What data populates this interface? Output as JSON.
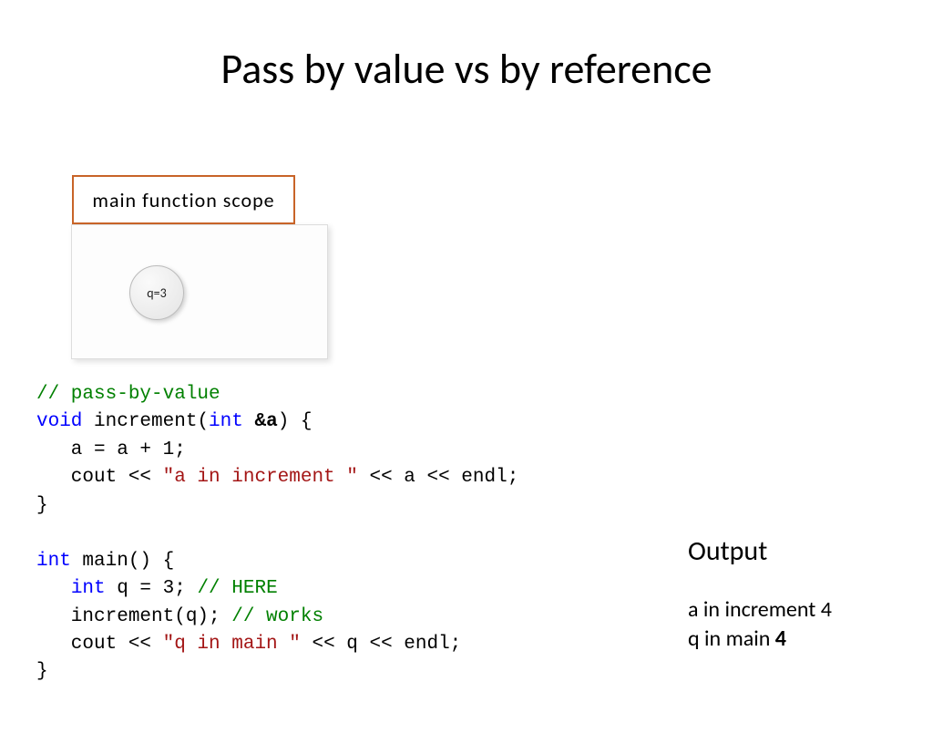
{
  "title": "Pass by value vs by reference",
  "scope": {
    "label": "main function scope",
    "variable": "q=3"
  },
  "code": {
    "l1": "// pass-by-value",
    "l2a": "void",
    "l2b": " increment(",
    "l2c": "int",
    "l2d": " ",
    "l2e": "&a",
    "l2f": ") {",
    "l3": "   a = a + 1;",
    "l4a": "   cout << ",
    "l4b": "\"a in increment \"",
    "l4c": " << a << endl;",
    "l5": "}",
    "l6": "",
    "l7a": "int",
    "l7b": " main() {",
    "l8a": "   ",
    "l8b": "int",
    "l8c": " q = 3; ",
    "l8d": "// HERE",
    "l9a": "   increment(q); ",
    "l9b": "// works",
    "l10a": "   cout << ",
    "l10b": "\"q in main \"",
    "l10c": " << q << endl;",
    "l11": "}"
  },
  "output": {
    "heading": "Output",
    "line1a": "a in increment ",
    "line1b": "4",
    "line2a": "q in main ",
    "line2b": "4"
  }
}
